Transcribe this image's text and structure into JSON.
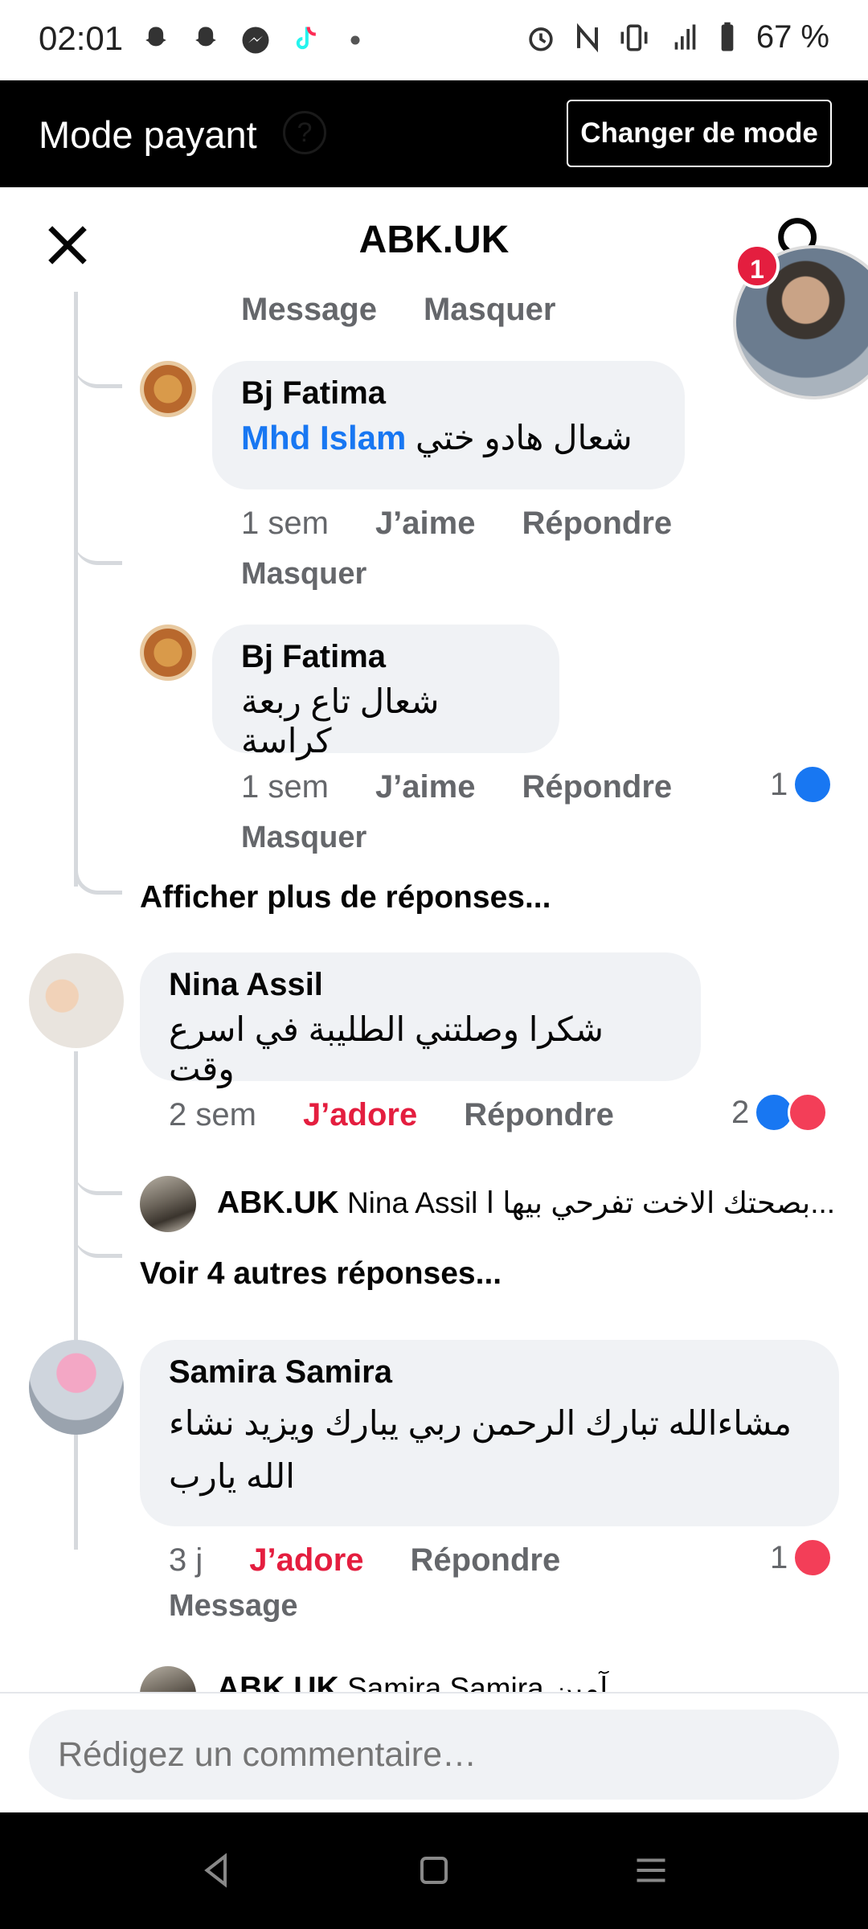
{
  "status_bar": {
    "time": "02:01",
    "battery": "67 %",
    "left_icons": [
      "snapchat-icon",
      "snapchat-icon",
      "messenger-icon",
      "tiktok-icon",
      "dot-icon"
    ],
    "right_icons": [
      "alarm-icon",
      "nfc-icon",
      "vibrate-icon",
      "signal-4g-icon",
      "battery-icon"
    ]
  },
  "mode_bar": {
    "title": "Mode payant",
    "help": "?",
    "button": "Changer de mode"
  },
  "header": {
    "title": "ABK.UK"
  },
  "chathead": {
    "badge": "1"
  },
  "top_actions": {
    "message": "Message",
    "hide": "Masquer"
  },
  "replies": [
    {
      "author": "Bj Fatima",
      "mention": "Mhd Islam",
      "text": "شعال هادو ختي",
      "time": "1 sem",
      "like": "J’aime",
      "reply": "Répondre",
      "hide": "Masquer",
      "reactions": ""
    },
    {
      "author": "Bj Fatima",
      "text": "شعال تاع ربعة كراسة",
      "time": "1 sem",
      "like": "J’aime",
      "reply": "Répondre",
      "hide": "Masquer",
      "reactions": "1"
    }
  ],
  "more_replies_1": "Afficher plus de réponses...",
  "comments": [
    {
      "author": "Nina Assil",
      "text": "شكرا وصلتني الطليبة في اسرع وقت",
      "time": "2 sem",
      "reaction_label": "J’adore",
      "reply": "Répondre",
      "reactions": "2",
      "sub_reply": {
        "author": "ABK.UK",
        "mention": "Nina Assil",
        "text": "بصحتك الاخت تفرحي بيها ا..."
      },
      "more": "Voir 4 autres réponses..."
    },
    {
      "author": "Samira Samira",
      "text": "مشاءالله تبارك الرحمن ربي يبارك ويزيد نشاء الله يارب",
      "time": "3 j",
      "reaction_label": "J’adore",
      "reply": "Répondre",
      "message": "Message",
      "reactions": "1",
      "sub_reply": {
        "author": "ABK.UK",
        "mention": "Samira Samira",
        "text": "آمين..."
      }
    }
  ],
  "composer": {
    "placeholder": "Rédigez un commentaire…"
  },
  "colors": {
    "brand_blue": "#1877f2",
    "love_red": "#e41e3f",
    "bubble_gray": "#f0f2f5",
    "secondary_text": "#65676b"
  }
}
